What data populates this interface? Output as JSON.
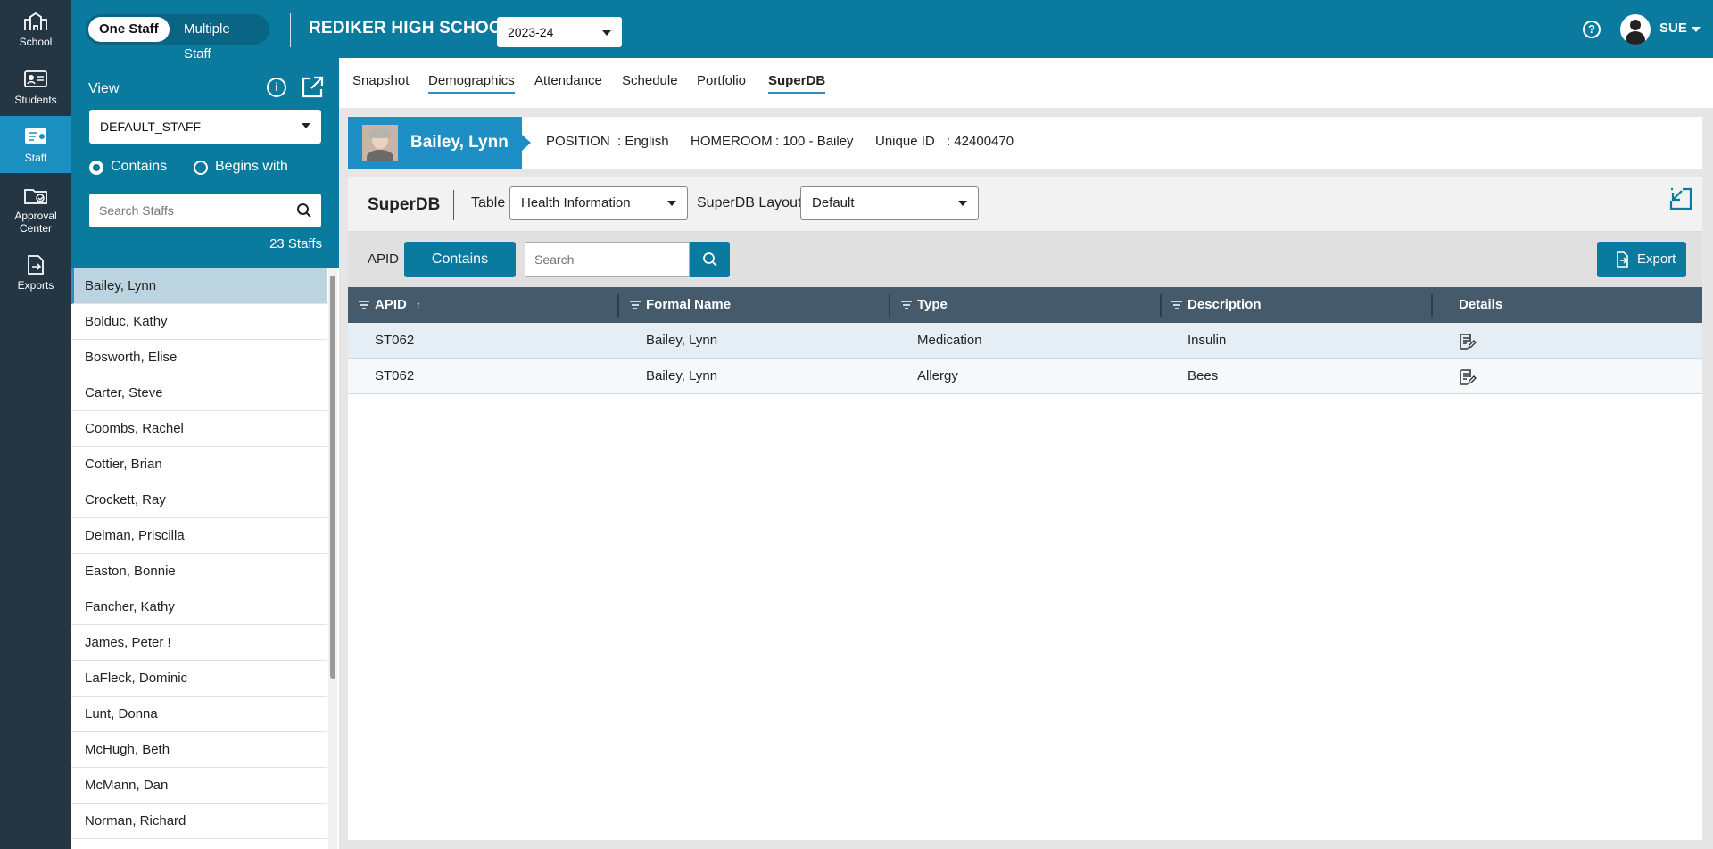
{
  "rail": [
    {
      "label": "School",
      "icon": "school-icon",
      "active": false
    },
    {
      "label": "Students",
      "icon": "students-icon",
      "active": false
    },
    {
      "label": "Staff",
      "icon": "staff-icon",
      "active": true
    },
    {
      "label_line1": "Approval",
      "label_line2": "Center",
      "icon": "approval-center-icon",
      "active": false
    },
    {
      "label": "Exports",
      "icon": "exports-icon",
      "active": false
    }
  ],
  "topbar": {
    "one_staff": "One Staff",
    "multiple_staff": "Multiple Staff",
    "school": "REDIKER HIGH SCHOOL",
    "year": "2023-24",
    "help": "?",
    "user": "SUE"
  },
  "panel": {
    "view_label": "View",
    "info": "i",
    "view_value": "DEFAULT_STAFF",
    "radio_contains": "Contains",
    "radio_begins": "Begins with",
    "search_placeholder": "Search Staffs",
    "count": "23 Staffs",
    "staff": [
      "Bailey, Lynn",
      "Bolduc, Kathy",
      "Bosworth, Elise",
      "Carter, Steve",
      "Coombs, Rachel",
      "Cottier, Brian",
      "Crockett, Ray",
      "Delman, Priscilla",
      "Easton, Bonnie",
      "Fancher, Kathy",
      "James, Peter !",
      "LaFleck, Dominic",
      "Lunt, Donna",
      "McHugh, Beth",
      "McMann, Dan",
      "Norman, Richard"
    ]
  },
  "tabs": [
    "Snapshot",
    "Demographics",
    "Attendance",
    "Schedule",
    "Portfolio",
    "SuperDB"
  ],
  "staff_bar": {
    "name": "Bailey, Lynn",
    "position_label": "POSITION",
    "position_value": ": English",
    "homeroom_label": "HOMEROOM",
    "homeroom_value": ": 100 - Bailey",
    "uid_label": "Unique ID",
    "uid_value": ": 42400470"
  },
  "superdb": {
    "title": "SuperDB",
    "table_label": "Table",
    "table_value": "Health Information",
    "layout_label": "SuperDB Layout",
    "layout_value": "Default",
    "apid_label": "APID",
    "contains_btn": "Contains",
    "search_placeholder": "Search",
    "export_btn": "Export",
    "columns": [
      "APID",
      "Formal Name",
      "Type",
      "Description",
      "Details"
    ],
    "sort_arrow": "↑",
    "rows": [
      {
        "apid": "ST062",
        "name": "Bailey, Lynn",
        "type": "Medication",
        "description": "Insulin"
      },
      {
        "apid": "ST062",
        "name": "Bailey, Lynn",
        "type": "Allergy",
        "description": "Bees"
      }
    ]
  },
  "colors": {
    "brand": "#0a7a9e",
    "rail": "#243544",
    "grid_header": "#455a6b"
  }
}
